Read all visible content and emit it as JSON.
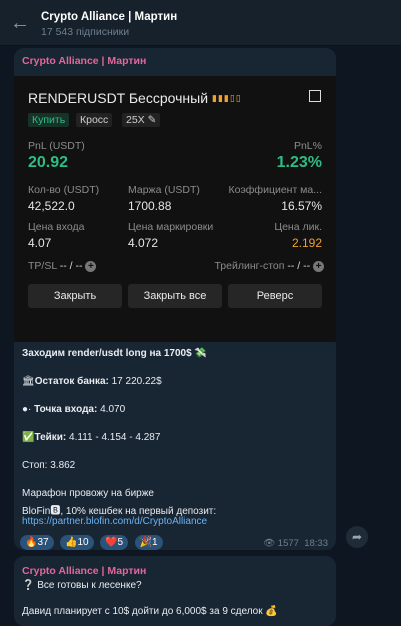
{
  "channel": {
    "title": "Crypto Alliance | Мартин",
    "subscribers": "17 543 підписники"
  },
  "message1": {
    "sender": "Crypto Alliance | Мартин",
    "card": {
      "pair": "RENDERUSDT Бессрочный",
      "side": "Купить",
      "margin_mode": "Кросс",
      "leverage": "25X",
      "pnl_label": "PnL (USDT)",
      "pnl_value": "20.92",
      "pnl_pct_label": "PnL%",
      "pnl_pct_value": "1.23%",
      "qty_label": "Кол-во (USDT)",
      "qty_value": "42,522.0",
      "margin_label": "Маржа (USDT)",
      "margin_value": "1700.88",
      "coef_label": "Коэффициент ма...",
      "coef_value": "16.57%",
      "entry_label": "Цена входа",
      "entry_value": "4.07",
      "mark_label": "Цена маркировки",
      "mark_value": "4.072",
      "liq_label": "Цена лик.",
      "liq_value": "2.192",
      "tpsl_label": "TP/SL",
      "tpsl_value": "-- / --",
      "trailing_label": "Трейлинг-стоп",
      "trailing_value": "-- / --",
      "btn_close": "Закрыть",
      "btn_close_all": "Закрыть все",
      "btn_reverse": "Реверс",
      "green": "#2ebd85",
      "orange": "#f0a12d"
    }
  },
  "message2": {
    "line1": "Заходим render/usdt long на 1700$ 💸",
    "line2_label": "Остаток банка:",
    "line2_value": " 17 220.22$",
    "line3_label": "Точка входа:",
    "line3_value": " 4.070",
    "line4_label": "Тейки:",
    "line4_value": " 4.111 - 4.154 - 4.287",
    "line5": "Стоп: 3.862",
    "line6": "Марафон провожу на бирже",
    "line7": "BloFin🅱, 10% кешбек на первый депозит:",
    "link": "https://partner.blofin.com/d/CryptoAlliance",
    "reactions": [
      {
        "emoji": "🔥",
        "count": "37"
      },
      {
        "emoji": "👍",
        "count": "10"
      },
      {
        "emoji": "❤️",
        "count": "5"
      },
      {
        "emoji": "🎉",
        "count": "1"
      }
    ],
    "views": "1577",
    "time": "18:33"
  },
  "message3": {
    "sender": "Crypto Alliance | Мартин",
    "line1": "❔ Все готовы к лесенке?",
    "line2": "Давид планирует с 10$ дойти до 6,000$ за 9 сделок 💰"
  }
}
